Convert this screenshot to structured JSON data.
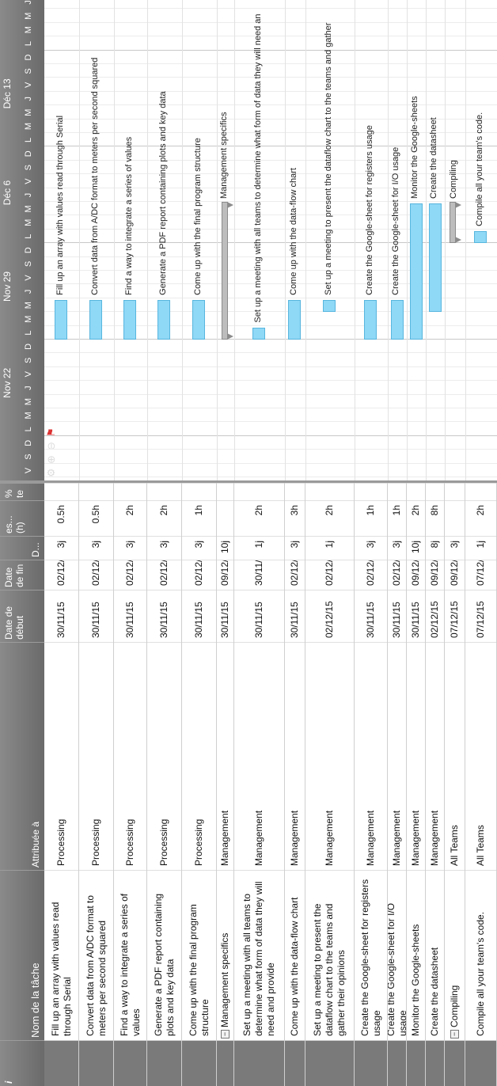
{
  "header": {
    "col_info": "i",
    "col_name": "Nom de la tâche",
    "col_assigned": "Attribuée à",
    "col_start": "Date de début",
    "col_end": "Date de fin",
    "col_dur": "D...",
    "col_est": "es... (h)",
    "col_pct": "% te",
    "col_top": "D..."
  },
  "gantt": {
    "weeks": [
      "Nov 22",
      "Nov 29",
      "Déc 6",
      "Déc 13"
    ],
    "day_letters": [
      "V",
      "S",
      "D",
      "L",
      "M",
      "M",
      "J",
      "V",
      "S",
      "D",
      "L",
      "M",
      "M",
      "J",
      "V",
      "S",
      "D",
      "L",
      "M",
      "M",
      "J",
      "V",
      "S",
      "D",
      "L",
      "M",
      "M",
      "J",
      "V",
      "S",
      "D",
      "L",
      "M",
      "M",
      "J",
      "V"
    ],
    "toolbar": [
      "gear-icon",
      "zoom-in-icon",
      "zoom-out-icon",
      "flag-icon"
    ],
    "bar_color": "#8fd8f6",
    "summary_color": "#bdbdbd"
  },
  "rows": [
    {
      "name": "Fill up an array with values read through Serial",
      "assigned": "Processing",
      "start": "30/11/15",
      "end": "02/12/15",
      "dur": "3j",
      "est": "0.5h",
      "summary": false
    },
    {
      "name": "Convert data from A/DC format to meters per second squared",
      "assigned": "Processing",
      "start": "30/11/15",
      "end": "02/12/15",
      "dur": "3j",
      "est": "0.5h",
      "summary": false
    },
    {
      "name": "Find a way to integrate a series of values",
      "assigned": "Processing",
      "start": "30/11/15",
      "end": "02/12/15",
      "dur": "3j",
      "est": "2h",
      "summary": false
    },
    {
      "name": "Generate a PDF report containing plots and key data",
      "assigned": "Processing",
      "start": "30/11/15",
      "end": "02/12/15",
      "dur": "3j",
      "est": "2h",
      "summary": false
    },
    {
      "name": "Come up with the final program structure",
      "assigned": "Processing",
      "start": "30/11/15",
      "end": "02/12/15",
      "dur": "3j",
      "est": "1h",
      "summary": false
    },
    {
      "name": "Management specifics",
      "assigned": "Management",
      "start": "30/11/15",
      "end": "09/12/15",
      "dur": "10j",
      "est": "",
      "summary": true
    },
    {
      "name": "Set up a meeting with all teams to determine what form of data they will need and provide",
      "assigned": "Management",
      "start": "30/11/15",
      "end": "30/11/15",
      "dur": "1j",
      "est": "2h",
      "summary": false
    },
    {
      "name": "Come up with the data-flow chart",
      "assigned": "Management",
      "start": "30/11/15",
      "end": "02/12/15",
      "dur": "3j",
      "est": "3h",
      "summary": false
    },
    {
      "name": "Set up a meeting to present the dataflow chart to the teams and gather their opinions",
      "assigned": "Management",
      "start": "02/12/15",
      "end": "02/12/15",
      "dur": "1j",
      "est": "2h",
      "summary": false
    },
    {
      "name": "Create the Google-sheet for registers usage",
      "assigned": "Management",
      "start": "30/11/15",
      "end": "02/12/15",
      "dur": "3j",
      "est": "1h",
      "summary": false
    },
    {
      "name": "Create the Google-sheet for I/O usage",
      "assigned": "Management",
      "start": "30/11/15",
      "end": "02/12/15",
      "dur": "3j",
      "est": "1h",
      "summary": false
    },
    {
      "name": "Monitor the Google-sheets",
      "assigned": "Management",
      "start": "30/11/15",
      "end": "09/12/15",
      "dur": "10j",
      "est": "2h",
      "summary": false
    },
    {
      "name": "Create the datasheet",
      "assigned": "Management",
      "start": "02/12/15",
      "end": "09/12/15",
      "dur": "8j",
      "est": "8h",
      "summary": false
    },
    {
      "name": "Compiling",
      "assigned": "All Teams",
      "start": "07/12/15",
      "end": "09/12/15",
      "dur": "3j",
      "est": "",
      "summary": true
    },
    {
      "name": "Compile all your team's code.",
      "assigned": "All Teams",
      "start": "07/12/15",
      "end": "07/12/15",
      "dur": "1j",
      "est": "2h",
      "summary": false
    }
  ],
  "gantt_labels": [
    "Fill up an array with values read through Serial",
    "Convert data from A/DC format to meters per second squared",
    "Find a way to integrate a series of values",
    "Generate a PDF report containing plots and key data",
    "Come up with the final program structure",
    "Management specifics",
    "Set up a meeting with all teams to determine what form of data they will need an",
    "Come up with the data-flow chart",
    "Set up a meeting to present the dataflow chart to the teams and gather",
    "Create the Google-sheet for registers usage",
    "Create the Google-sheet for I/O usage",
    "Monitor the Google-sheets",
    "Create the datasheet",
    "Compiling",
    "Compile all your team's code."
  ]
}
